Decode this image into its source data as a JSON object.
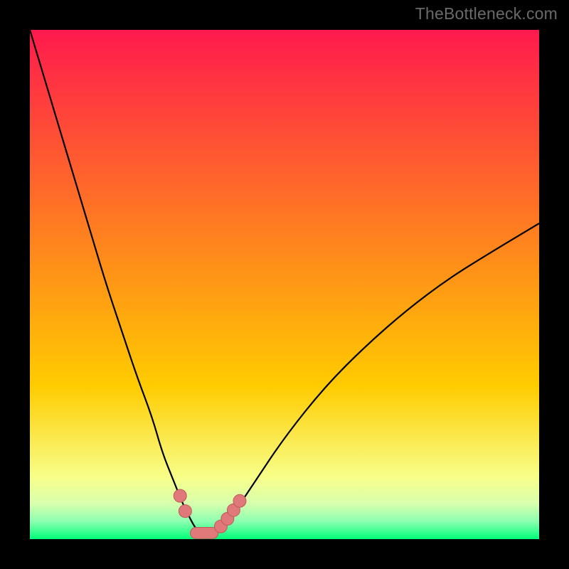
{
  "watermark": "TheBottleneck.com",
  "colors": {
    "frame": "#000000",
    "gradient_top": "#ff1a4d",
    "gradient_mid": "#ffcc00",
    "gradient_low": "#f7ff8a",
    "gradient_bottom": "#00ff7a",
    "curve": "#000000",
    "marker_fill": "#e07a7a",
    "marker_stroke": "#c05858"
  },
  "chart_data": {
    "type": "line",
    "title": "",
    "xlabel": "",
    "ylabel": "",
    "xlim": [
      0,
      100
    ],
    "ylim": [
      0,
      100
    ],
    "series": [
      {
        "name": "bottleneck-curve",
        "x": [
          0,
          3,
          6,
          9,
          12,
          15,
          18,
          21,
          24,
          26,
          28,
          30,
          31,
          32,
          33,
          33.5,
          34,
          35,
          36,
          37,
          38,
          40,
          44,
          50,
          58,
          66,
          74,
          82,
          90,
          100
        ],
        "y": [
          100,
          90,
          80,
          70,
          60,
          50,
          41,
          32,
          24,
          17,
          12,
          7,
          5,
          3,
          1.5,
          1,
          1,
          1,
          1,
          1.5,
          2.5,
          5,
          11,
          20,
          30,
          38,
          45,
          51,
          56,
          62
        ]
      }
    ],
    "markers": {
      "name": "highlight-points",
      "points": [
        {
          "x": 29.5,
          "y": 8.5
        },
        {
          "x": 30.5,
          "y": 5.5
        },
        {
          "x": 37.5,
          "y": 2.5
        },
        {
          "x": 38.8,
          "y": 4.0
        },
        {
          "x": 40.0,
          "y": 5.7
        },
        {
          "x": 41.2,
          "y": 7.5
        }
      ],
      "bar": {
        "x0": 31.5,
        "x1": 37.0,
        "y": 1.2,
        "h": 2.2
      }
    }
  }
}
